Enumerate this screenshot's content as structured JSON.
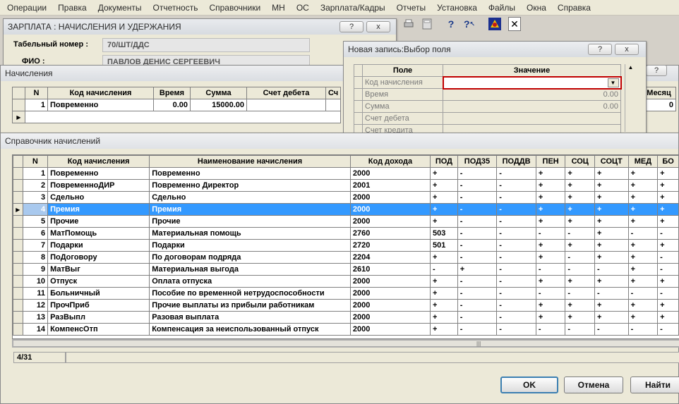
{
  "menu": [
    "Операции",
    "Правка",
    "Документы",
    "Отчетность",
    "Справочники",
    "МН",
    "ОС",
    "Зарплата/Кадры",
    "Отчеты",
    "Установка",
    "Файлы",
    "Окна",
    "Справка"
  ],
  "zarplata": {
    "title": "ЗАРПЛАТА : НАЧИСЛЕНИЯ И УДЕРЖАНИЯ",
    "tab_label": "Табельный номер :",
    "tab_value": "70/ШТ/ДДС",
    "fio_label": "ФИО :",
    "fio_value": "ПАВЛОВ ДЕНИС СЕРГЕЕВИЧ",
    "help_btn": "?",
    "close_btn": "x"
  },
  "nach": {
    "title": "Начисления",
    "headers": [
      "N",
      "Код начисления",
      "Время",
      "Сумма",
      "Счет дебета",
      "Сч"
    ],
    "right_header": "Месяц",
    "row": {
      "n": "1",
      "code": "Повременно",
      "time": "0.00",
      "sum": "15000.00",
      "month": "0"
    }
  },
  "new_record": {
    "title": "Новая запись:Выбор поля",
    "col_field": "Поле",
    "col_value": "Значение",
    "rows": [
      {
        "field": "Код начисления",
        "value": ""
      },
      {
        "field": "Время",
        "value": "0.00"
      },
      {
        "field": "Сумма",
        "value": "0.00"
      },
      {
        "field": "Счет дебета",
        "value": ""
      },
      {
        "field": "Счет кредита",
        "value": ""
      }
    ],
    "help_btn": "?",
    "close_btn": "x"
  },
  "reference": {
    "title": "Справочник начислений",
    "headers": [
      "N",
      "Код начисления",
      "Наименование начисления",
      "Код дохода",
      "ПОД",
      "ПОД35",
      "ПОДДВ",
      "ПЕН",
      "СОЦ",
      "СОЦТ",
      "МЕД",
      "БО"
    ],
    "rows": [
      {
        "n": "1",
        "code": "Повременно",
        "name": "Повременно",
        "income": "2000",
        "pod": "+",
        "pod35": "-",
        "poddv": "-",
        "pen": "+",
        "soc": "+",
        "soct": "+",
        "med": "+",
        "bo": "+"
      },
      {
        "n": "2",
        "code": "ПовременноДИР",
        "name": "Повременно Директор",
        "income": "2001",
        "pod": "+",
        "pod35": "-",
        "poddv": "-",
        "pen": "+",
        "soc": "+",
        "soct": "+",
        "med": "+",
        "bo": "+"
      },
      {
        "n": "3",
        "code": "Сдельно",
        "name": "Сдельно",
        "income": "2000",
        "pod": "+",
        "pod35": "-",
        "poddv": "-",
        "pen": "+",
        "soc": "+",
        "soct": "+",
        "med": "+",
        "bo": "+"
      },
      {
        "n": "4",
        "code": "Премия",
        "name": "Премия",
        "income": "2000",
        "pod": "+",
        "pod35": "-",
        "poddv": "-",
        "pen": "+",
        "soc": "+",
        "soct": "+",
        "med": "+",
        "bo": "+"
      },
      {
        "n": "5",
        "code": "Прочие",
        "name": "Прочие",
        "income": "2000",
        "pod": "+",
        "pod35": "-",
        "poddv": "-",
        "pen": "+",
        "soc": "+",
        "soct": "+",
        "med": "+",
        "bo": "+"
      },
      {
        "n": "6",
        "code": "МатПомощь",
        "name": "Материальная помощь",
        "income": "2760",
        "pod": "503",
        "pod35": "-",
        "poddv": "-",
        "pen": "-",
        "soc": "-",
        "soct": "+",
        "med": "-",
        "bo": "-"
      },
      {
        "n": "7",
        "code": "Подарки",
        "name": "Подарки",
        "income": "2720",
        "pod": "501",
        "pod35": "-",
        "poddv": "-",
        "pen": "+",
        "soc": "+",
        "soct": "+",
        "med": "+",
        "bo": "+"
      },
      {
        "n": "8",
        "code": "ПоДоговору",
        "name": "По договорам подряда",
        "income": "2204",
        "pod": "+",
        "pod35": "-",
        "poddv": "-",
        "pen": "+",
        "soc": "-",
        "soct": "+",
        "med": "+",
        "bo": "-"
      },
      {
        "n": "9",
        "code": "МатВыг",
        "name": "Материальная выгода",
        "income": "2610",
        "pod": "-",
        "pod35": "+",
        "poddv": "-",
        "pen": "-",
        "soc": "-",
        "soct": "-",
        "med": "+",
        "bo": "-"
      },
      {
        "n": "10",
        "code": "Отпуск",
        "name": "Оплата отпуска",
        "income": "2000",
        "pod": "+",
        "pod35": "-",
        "poddv": "-",
        "pen": "+",
        "soc": "+",
        "soct": "+",
        "med": "+",
        "bo": "+"
      },
      {
        "n": "11",
        "code": "Больничный",
        "name": "Пособие по временной нетрудоспособности",
        "income": "2000",
        "pod": "+",
        "pod35": "-",
        "poddv": "-",
        "pen": "-",
        "soc": "-",
        "soct": "-",
        "med": "-",
        "bo": "-"
      },
      {
        "n": "12",
        "code": "ПрочПриб",
        "name": "Прочие выплаты из прибыли работникам",
        "income": "2000",
        "pod": "+",
        "pod35": "-",
        "poddv": "-",
        "pen": "+",
        "soc": "+",
        "soct": "+",
        "med": "+",
        "bo": "+"
      },
      {
        "n": "13",
        "code": "РазВыпл",
        "name": "Разовая выплата",
        "income": "2000",
        "pod": "+",
        "pod35": "-",
        "poddv": "-",
        "pen": "+",
        "soc": "+",
        "soct": "+",
        "med": "+",
        "bo": "+"
      },
      {
        "n": "14",
        "code": "КомпенсОтп",
        "name": "Компенсация за неиспользованный отпуск",
        "income": "2000",
        "pod": "+",
        "pod35": "-",
        "poddv": "-",
        "pen": "-",
        "soc": "-",
        "soct": "-",
        "med": "-",
        "bo": "-"
      }
    ],
    "selected_index": 3,
    "status": "4/31",
    "buttons": {
      "ok": "OK",
      "cancel": "Отмена",
      "find": "Найти"
    }
  },
  "colors": {
    "selection": "#3399ff",
    "menubar": "#ece9d8",
    "window_bg": "#ece9d8",
    "error_border": "#c00000"
  }
}
